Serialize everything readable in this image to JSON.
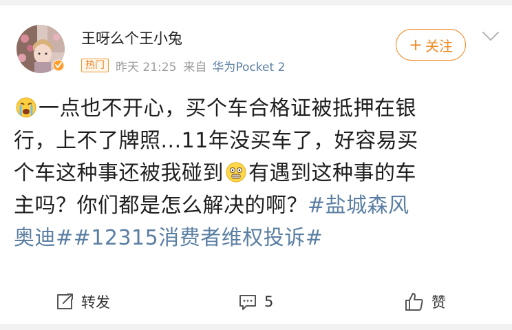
{
  "user": {
    "name": "王呀么个王小兔",
    "badge": "热门",
    "time": "昨天 21:25",
    "source_prefix": "来自",
    "device": "华为Pocket 2"
  },
  "follow": {
    "plus": "+",
    "label": "关注"
  },
  "post": {
    "line1": "一点也不开心，买个车合格证被抵押在银",
    "line2": "行，上不了牌照...11年没买车了，好容易买",
    "line3a": "个车这种事还被我碰到",
    "line3b": "有遇到这种事的车",
    "line4a": "主吗？你们都是怎么解决的啊？",
    "tag1_part1": "#盐城森风",
    "tag1_part2": "奥迪#",
    "tag2": "#12315消费者维权投诉#"
  },
  "actions": {
    "repost_label": "转发",
    "comment_count": "5",
    "like_label": "赞"
  },
  "colors": {
    "accent": "#f08a24",
    "link": "#5b7fa3",
    "badge_text": "#e8862a",
    "meta": "#9b9b9b"
  },
  "icons": [
    "avatar-image",
    "verified-badge-icon",
    "chevron-down-icon",
    "crying-face-icon",
    "speechless-face-icon",
    "repost-icon",
    "comment-icon",
    "thumbs-up-icon"
  ]
}
